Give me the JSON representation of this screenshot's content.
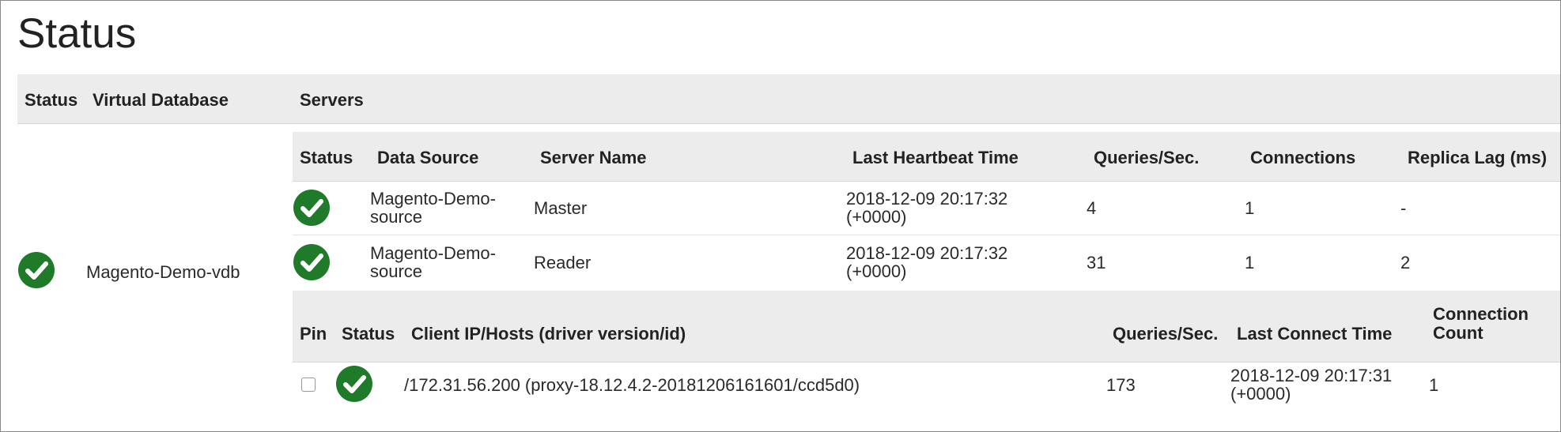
{
  "page": {
    "title": "Status"
  },
  "colors": {
    "ok_green": "#1f7a2a",
    "header_bg": "#ececec"
  },
  "outer_table": {
    "headers": {
      "status": "Status",
      "virtual_database": "Virtual Database",
      "servers": "Servers"
    },
    "row": {
      "status_icon": "check-circle-icon",
      "virtual_database": "Magento-Demo-vdb"
    }
  },
  "servers_table": {
    "headers": {
      "status": "Status",
      "data_source": "Data Source",
      "server_name": "Server Name",
      "last_heartbeat": "Last Heartbeat Time",
      "queries": "Queries/Sec.",
      "connections": "Connections",
      "replica_lag": "Replica Lag (ms)"
    },
    "rows": [
      {
        "status_icon": "check-circle-icon",
        "data_source_line1": "Magento-Demo-",
        "data_source_line2": "source",
        "server_name": "Master",
        "heartbeat_line1": "2018-12-09 20:17:32",
        "heartbeat_line2": "(+0000)",
        "queries": "4",
        "connections": "1",
        "replica_lag": "-"
      },
      {
        "status_icon": "check-circle-icon",
        "data_source_line1": "Magento-Demo-",
        "data_source_line2": "source",
        "server_name": "Reader",
        "heartbeat_line1": "2018-12-09 20:17:32",
        "heartbeat_line2": "(+0000)",
        "queries": "31",
        "connections": "1",
        "replica_lag": "2"
      }
    ]
  },
  "clients_table": {
    "headers": {
      "pin": "Pin",
      "status": "Status",
      "client": "Client IP/Hosts (driver version/id)",
      "queries": "Queries/Sec.",
      "last_connect": "Last Connect Time",
      "conn_count_line1": "Connection",
      "conn_count_line2": "Count"
    },
    "rows": [
      {
        "pinned": false,
        "status_icon": "check-circle-icon",
        "client": "/172.31.56.200 (proxy-18.12.4.2-20181206161601/ccd5d0)",
        "queries": "173",
        "last_connect_line1": "2018-12-09 20:17:31",
        "last_connect_line2": "(+0000)",
        "conn_count": "1"
      }
    ]
  }
}
